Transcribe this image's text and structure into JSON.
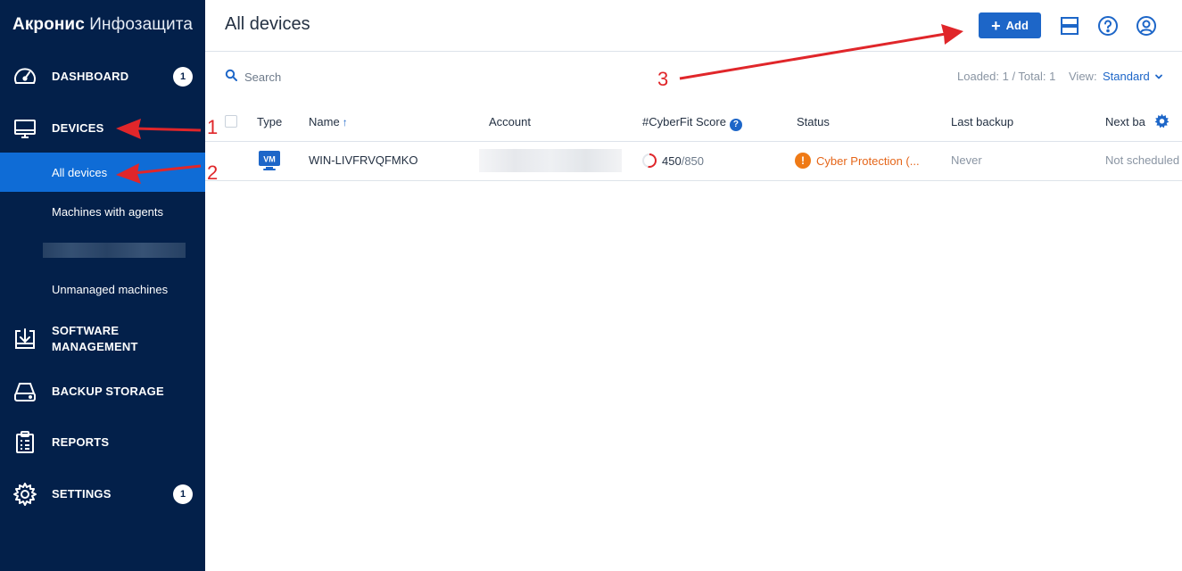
{
  "brand": {
    "part1": "Акронис",
    "part2": "Инфозащита"
  },
  "sidebar": {
    "items": [
      {
        "id": "dashboard",
        "label": "DASHBOARD",
        "icon": "dashboard-gauge-icon",
        "badge": "1"
      },
      {
        "id": "devices",
        "label": "DEVICES",
        "icon": "monitor-icon"
      },
      {
        "id": "software",
        "label": "SOFTWARE MANAGEMENT",
        "icon": "download-box-icon"
      },
      {
        "id": "backup",
        "label": "BACKUP STORAGE",
        "icon": "hard-drive-icon"
      },
      {
        "id": "reports",
        "label": "REPORTS",
        "icon": "clipboard-icon"
      },
      {
        "id": "settings",
        "label": "SETTINGS",
        "icon": "gear-icon",
        "badge": "1"
      }
    ],
    "devices_sub": [
      {
        "label": "All devices",
        "active": true
      },
      {
        "label": "Machines with agents",
        "active": false
      },
      {
        "label": "Unmanaged machines",
        "active": false
      }
    ]
  },
  "header": {
    "title": "All devices",
    "add_label": "Add",
    "icons": [
      "layout-icon",
      "help-icon",
      "user-icon"
    ]
  },
  "toolbar": {
    "search_placeholder": "Search",
    "loaded": "Loaded: 1 / Total: 1",
    "view_label": "View:",
    "view_value": "Standard"
  },
  "table": {
    "columns": {
      "type": "Type",
      "name": "Name",
      "account": "Account",
      "score": "#CyberFit Score",
      "status": "Status",
      "last_backup": "Last backup",
      "next_backup": "Next ba"
    },
    "rows": [
      {
        "type": "VM",
        "name": "WIN-LIVFRVQFMKO",
        "score": "450",
        "score_max": "/850",
        "score_fraction": 0.53,
        "status": "Cyber Protection (...",
        "last_backup": "Never",
        "next_backup": "Not scheduled"
      }
    ]
  },
  "annotations": [
    "1",
    "2",
    "3"
  ],
  "colors": {
    "sidebar_bg": "#03204a",
    "accent": "#1d66c8",
    "active_item": "#0f6cd6",
    "warning": "#ef7a16",
    "annotation": "#e0262a"
  }
}
